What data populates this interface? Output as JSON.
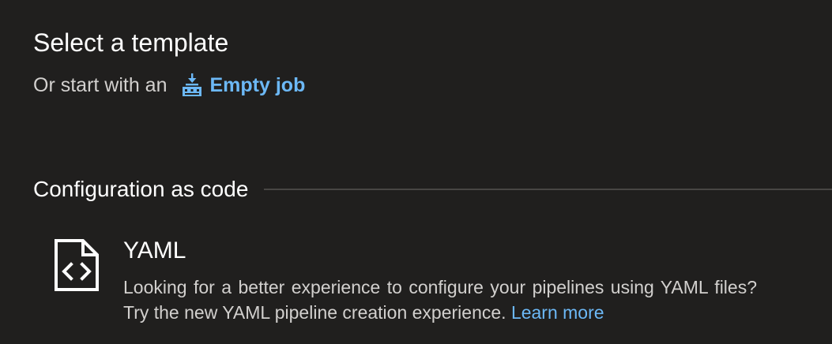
{
  "header": {
    "title": "Select a template",
    "start_prefix": "Or start with an",
    "empty_job_label": "Empty job",
    "empty_job_icon": "pipeline-job-icon"
  },
  "section": {
    "title": "Configuration as code"
  },
  "yaml": {
    "icon": "code-file-icon",
    "title": "YAML",
    "description": "Looking for a better experience to configure your pipelines using YAML files? Try the new YAML pipeline creation experience.",
    "learn_more": "Learn more"
  },
  "colors": {
    "background": "#201f1e",
    "link": "#6cb8f6",
    "text_primary": "#ffffff",
    "text_secondary": "#d2d0ce",
    "divider": "#484644"
  }
}
